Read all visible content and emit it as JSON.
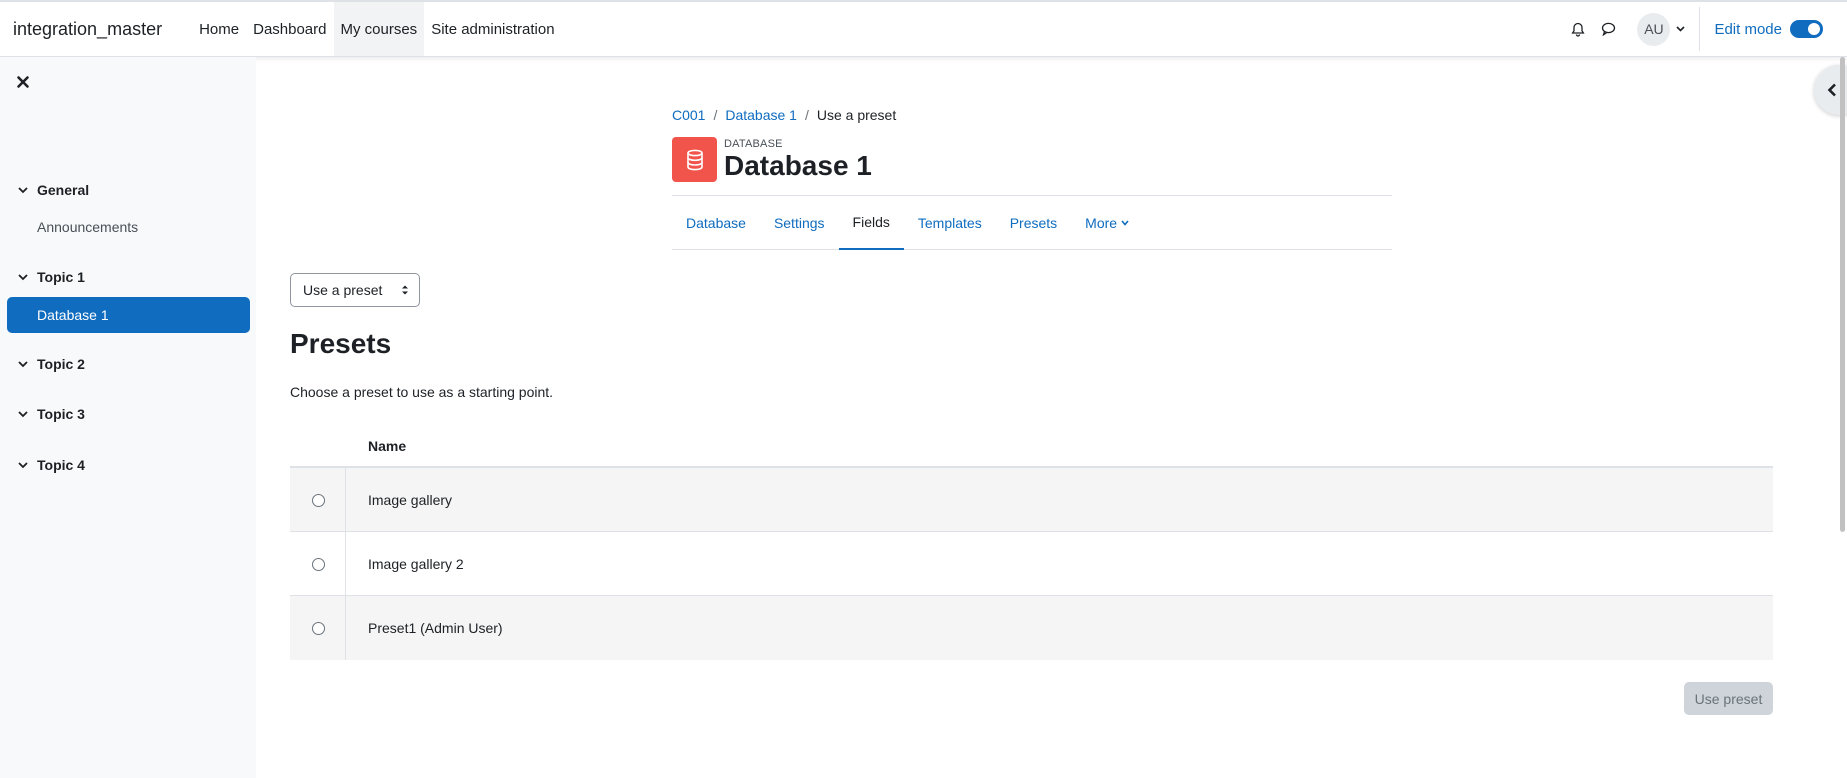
{
  "navbar": {
    "brand": "integration_master",
    "items": [
      {
        "label": "Home",
        "active": false
      },
      {
        "label": "Dashboard",
        "active": false
      },
      {
        "label": "My courses",
        "active": true
      },
      {
        "label": "Site administration",
        "active": false
      }
    ],
    "user_initials": "AU",
    "edit_mode_label": "Edit mode",
    "edit_mode_on": true,
    "icons": [
      "bell-icon",
      "chat-icon",
      "chevron-down-icon"
    ]
  },
  "sidebar": {
    "sections": [
      {
        "label": "General",
        "items": [
          {
            "label": "Announcements",
            "active": false
          }
        ]
      },
      {
        "label": "Topic 1",
        "items": [
          {
            "label": "Database 1",
            "active": true
          }
        ]
      },
      {
        "label": "Topic 2",
        "items": []
      },
      {
        "label": "Topic 3",
        "items": []
      },
      {
        "label": "Topic 4",
        "items": []
      }
    ]
  },
  "header": {
    "breadcrumb": [
      {
        "label": "C001",
        "link": true
      },
      {
        "label": "Database 1",
        "link": true
      },
      {
        "label": "Use a preset",
        "link": false
      }
    ],
    "module_type": "DATABASE",
    "title": "Database 1"
  },
  "tabs": [
    {
      "label": "Database",
      "active": false
    },
    {
      "label": "Settings",
      "active": false
    },
    {
      "label": "Fields",
      "active": true
    },
    {
      "label": "Templates",
      "active": false
    },
    {
      "label": "Presets",
      "active": false
    },
    {
      "label": "More",
      "active": false
    }
  ],
  "main": {
    "select_value": "Use a preset",
    "heading": "Presets",
    "description": "Choose a preset to use as a starting point.",
    "table": {
      "columns": [
        "",
        "Name"
      ],
      "rows": [
        {
          "name": "Image gallery",
          "selected": false
        },
        {
          "name": "Image gallery 2",
          "selected": false
        },
        {
          "name": "Preset1 (Admin User)",
          "selected": false
        }
      ]
    },
    "use_preset_button": "Use preset"
  },
  "colors": {
    "primary": "#0f6cbf",
    "module_icon_bg": "#f0544b",
    "sidebar_bg": "#f8f9fa",
    "disabled_button_bg": "#ced4da"
  }
}
